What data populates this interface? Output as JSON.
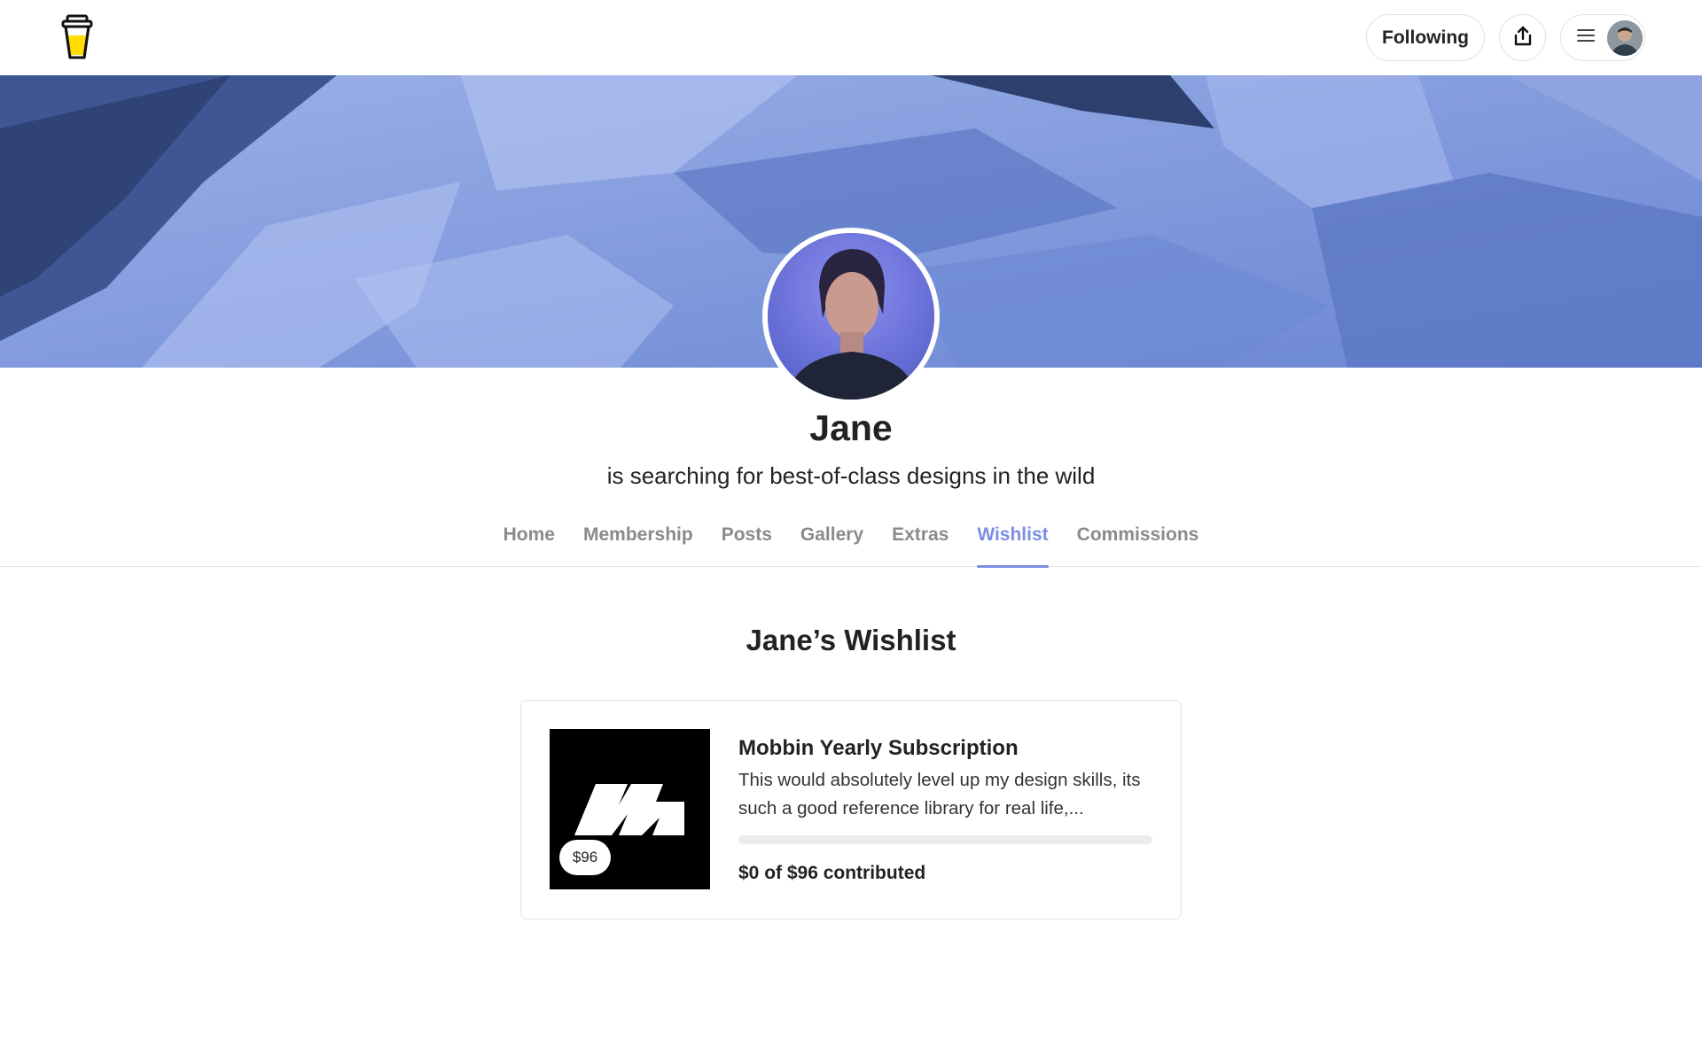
{
  "header": {
    "following_label": "Following",
    "share_icon": "share-icon",
    "menu_icon": "hamburger-menu-icon",
    "logo_icon": "coffee-cup-logo-icon"
  },
  "profile": {
    "name": "Jane",
    "tagline": "is searching for best-of-class designs in the wild"
  },
  "tabs": [
    {
      "label": "Home",
      "active": false
    },
    {
      "label": "Membership",
      "active": false
    },
    {
      "label": "Posts",
      "active": false
    },
    {
      "label": "Gallery",
      "active": false
    },
    {
      "label": "Extras",
      "active": false
    },
    {
      "label": "Wishlist",
      "active": true
    },
    {
      "label": "Commissions",
      "active": false
    }
  ],
  "wishlist": {
    "title": "Jane’s Wishlist",
    "items": [
      {
        "title": "Mobbin Yearly Subscription",
        "description": "This would absolutely level up my design skills, its such a good reference library for real life,...",
        "price_badge": "$96",
        "contributed_text": "$0 of $96 contributed",
        "progress_fraction": 0
      }
    ]
  },
  "colors": {
    "accent": "#7d8fe3",
    "text": "#222222",
    "muted_tab": "#8a8a8a",
    "cover_blue": "#6f8ad6"
  }
}
